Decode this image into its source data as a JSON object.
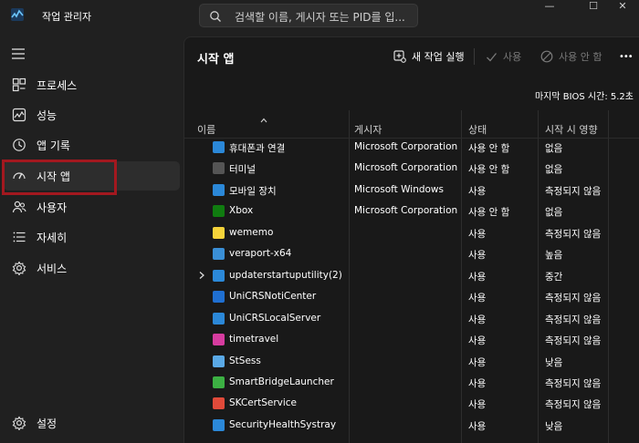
{
  "app": {
    "title": "작업 관리자"
  },
  "search": {
    "placeholder": "검색할 이름, 게시자 또는 PID를 입..."
  },
  "window_controls": {
    "minimize": "—",
    "maximize": "☐",
    "close": "✕"
  },
  "sidebar": {
    "items": [
      {
        "label": "프로세스",
        "icon": "processes-icon"
      },
      {
        "label": "성능",
        "icon": "performance-icon"
      },
      {
        "label": "앱 기록",
        "icon": "app-history-icon"
      },
      {
        "label": "시작 앱",
        "icon": "startup-apps-icon",
        "active": true
      },
      {
        "label": "사용자",
        "icon": "users-icon"
      },
      {
        "label": "자세히",
        "icon": "details-icon"
      },
      {
        "label": "서비스",
        "icon": "services-icon"
      }
    ],
    "settings_label": "설정"
  },
  "main": {
    "title": "시작 앱",
    "toolbar": {
      "run_new_task": "새 작업 실행",
      "enable": "사용",
      "disable": "사용 안 함",
      "more": "•••"
    },
    "bios_label": "마지막 BIOS 시간:",
    "bios_value": "5.2초",
    "columns": [
      "이름",
      "게시자",
      "상태",
      "시작 시 영향"
    ],
    "rows": [
      {
        "name": "휴대폰과 연결",
        "publisher": "Microsoft Corporation",
        "status": "사용 안 함",
        "impact": "없음",
        "icon": "phone-link-icon",
        "color": "#2b88d8"
      },
      {
        "name": "터미널",
        "publisher": "Microsoft Corporation",
        "status": "사용 안 함",
        "impact": "없음",
        "icon": "terminal-icon",
        "color": "#555555"
      },
      {
        "name": "모바일 장치",
        "publisher": "Microsoft Windows",
        "status": "사용",
        "impact": "측정되지 않음",
        "icon": "mobile-device-icon",
        "color": "#2b88d8"
      },
      {
        "name": "Xbox",
        "publisher": "Microsoft Corporation",
        "status": "사용 안 함",
        "impact": "없음",
        "icon": "xbox-icon",
        "color": "#107c10"
      },
      {
        "name": "wememo",
        "publisher": "",
        "status": "사용",
        "impact": "측정되지 않음",
        "icon": "memo-icon",
        "color": "#f5d33a"
      },
      {
        "name": "veraport-x64",
        "publisher": "",
        "status": "사용",
        "impact": "높음",
        "icon": "veraport-icon",
        "color": "#3a8fd6"
      },
      {
        "name": "updaterstartuputility(2)",
        "publisher": "",
        "status": "사용",
        "impact": "중간",
        "icon": "updater-icon",
        "color": "#2b88d8",
        "expandable": true
      },
      {
        "name": "UniCRSNotiCenter",
        "publisher": "",
        "status": "사용",
        "impact": "측정되지 않음",
        "icon": "unicrs-noti-icon",
        "color": "#1f6fd1"
      },
      {
        "name": "UniCRSLocalServer",
        "publisher": "",
        "status": "사용",
        "impact": "측정되지 않음",
        "icon": "unicrs-server-icon",
        "color": "#2b88d8"
      },
      {
        "name": "timetravel",
        "publisher": "",
        "status": "사용",
        "impact": "측정되지 않음",
        "icon": "timetravel-icon",
        "color": "#d63c9f"
      },
      {
        "name": "StSess",
        "publisher": "",
        "status": "사용",
        "impact": "낮음",
        "icon": "stsess-icon",
        "color": "#5aa9e6"
      },
      {
        "name": "SmartBridgeLauncher",
        "publisher": "",
        "status": "사용",
        "impact": "측정되지 않음",
        "icon": "smartbridge-icon",
        "color": "#3cb043"
      },
      {
        "name": "SKCertService",
        "publisher": "",
        "status": "사용",
        "impact": "측정되지 않음",
        "icon": "skcert-icon",
        "color": "#e04a3a"
      },
      {
        "name": "SecurityHealthSystray",
        "publisher": "",
        "status": "사용",
        "impact": "낮음",
        "icon": "security-health-icon",
        "color": "#2b88d8"
      }
    ]
  }
}
